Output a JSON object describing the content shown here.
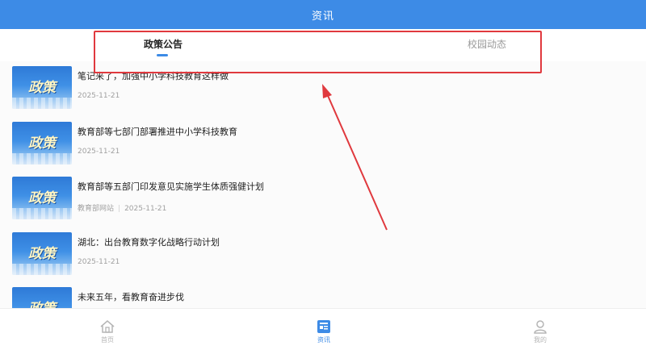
{
  "header": {
    "title": "资讯"
  },
  "tabs": [
    {
      "label": "政策公告",
      "active": true
    },
    {
      "label": "校园动态",
      "active": false
    }
  ],
  "thumbnail_label": "政策",
  "articles": [
    {
      "title": "笔记来了，加强中小学科技教育这样做",
      "source": "",
      "date": "2025-11-21"
    },
    {
      "title": "教育部等七部门部署推进中小学科技教育",
      "source": "",
      "date": "2025-11-21"
    },
    {
      "title": "教育部等五部门印发意见实施学生体质强健计划",
      "source": "教育部网站",
      "date": "2025-11-21"
    },
    {
      "title": "湖北：出台教育数字化战略行动计划",
      "source": "",
      "date": "2025-11-21"
    },
    {
      "title": "未来五年，看教育奋进步伐",
      "source": "",
      "date": ""
    }
  ],
  "bottom_nav": [
    {
      "label": "首页",
      "icon": "home-icon",
      "active": false
    },
    {
      "label": "资讯",
      "icon": "news-icon",
      "active": true
    },
    {
      "label": "我的",
      "icon": "user-icon",
      "active": false
    }
  ],
  "colors": {
    "primary": "#3d8be6",
    "annotation": "#e0393e"
  }
}
